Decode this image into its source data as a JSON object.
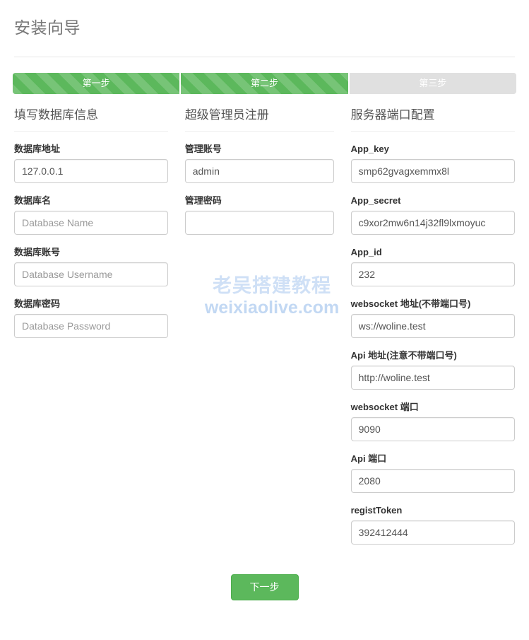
{
  "header": {
    "title": "安装向导"
  },
  "steps": [
    {
      "label": "第一步",
      "state": "active"
    },
    {
      "label": "第二步",
      "state": "active"
    },
    {
      "label": "第三步",
      "state": "idle"
    }
  ],
  "colors": {
    "step_active": "#5cb85c",
    "step_idle": "#e0e0e0",
    "button": "#5cb85c",
    "title_text": "#777777",
    "watermark_primary": "#cfe0f6",
    "watermark_secondary": "#c2d8f3"
  },
  "columns": {
    "database": {
      "title": "填写数据库信息",
      "fields": [
        {
          "label": "数据库地址",
          "value": "127.0.0.1",
          "placeholder": ""
        },
        {
          "label": "数据库名",
          "value": "",
          "placeholder": "Database Name"
        },
        {
          "label": "数据库账号",
          "value": "",
          "placeholder": "Database Username"
        },
        {
          "label": "数据库密码",
          "value": "",
          "placeholder": "Database Password"
        }
      ]
    },
    "admin": {
      "title": "超级管理员注册",
      "fields": [
        {
          "label": "管理账号",
          "value": "admin",
          "placeholder": ""
        },
        {
          "label": "管理密码",
          "value": "",
          "placeholder": ""
        }
      ]
    },
    "server": {
      "title": "服务器端口配置",
      "fields": [
        {
          "label": "App_key",
          "value": "smp62gvagxemmx8l",
          "placeholder": ""
        },
        {
          "label": "App_secret",
          "value": "c9xor2mw6n14j32fl9lxmoyuc",
          "placeholder": ""
        },
        {
          "label": "App_id",
          "value": "232",
          "placeholder": ""
        },
        {
          "label": "websocket 地址(不带端口号)",
          "value": "ws://woline.test",
          "placeholder": ""
        },
        {
          "label": "Api 地址(注意不带端口号)",
          "value": "http://woline.test",
          "placeholder": ""
        },
        {
          "label": "websocket 端口",
          "value": "9090",
          "placeholder": ""
        },
        {
          "label": "Api 端口",
          "value": "2080",
          "placeholder": ""
        },
        {
          "label": "registToken",
          "value": "392412444",
          "placeholder": ""
        }
      ]
    }
  },
  "watermark": {
    "line1": "老吴搭建教程",
    "line2": "weixiaolive.com"
  },
  "footer": {
    "next_label": "下一步"
  }
}
